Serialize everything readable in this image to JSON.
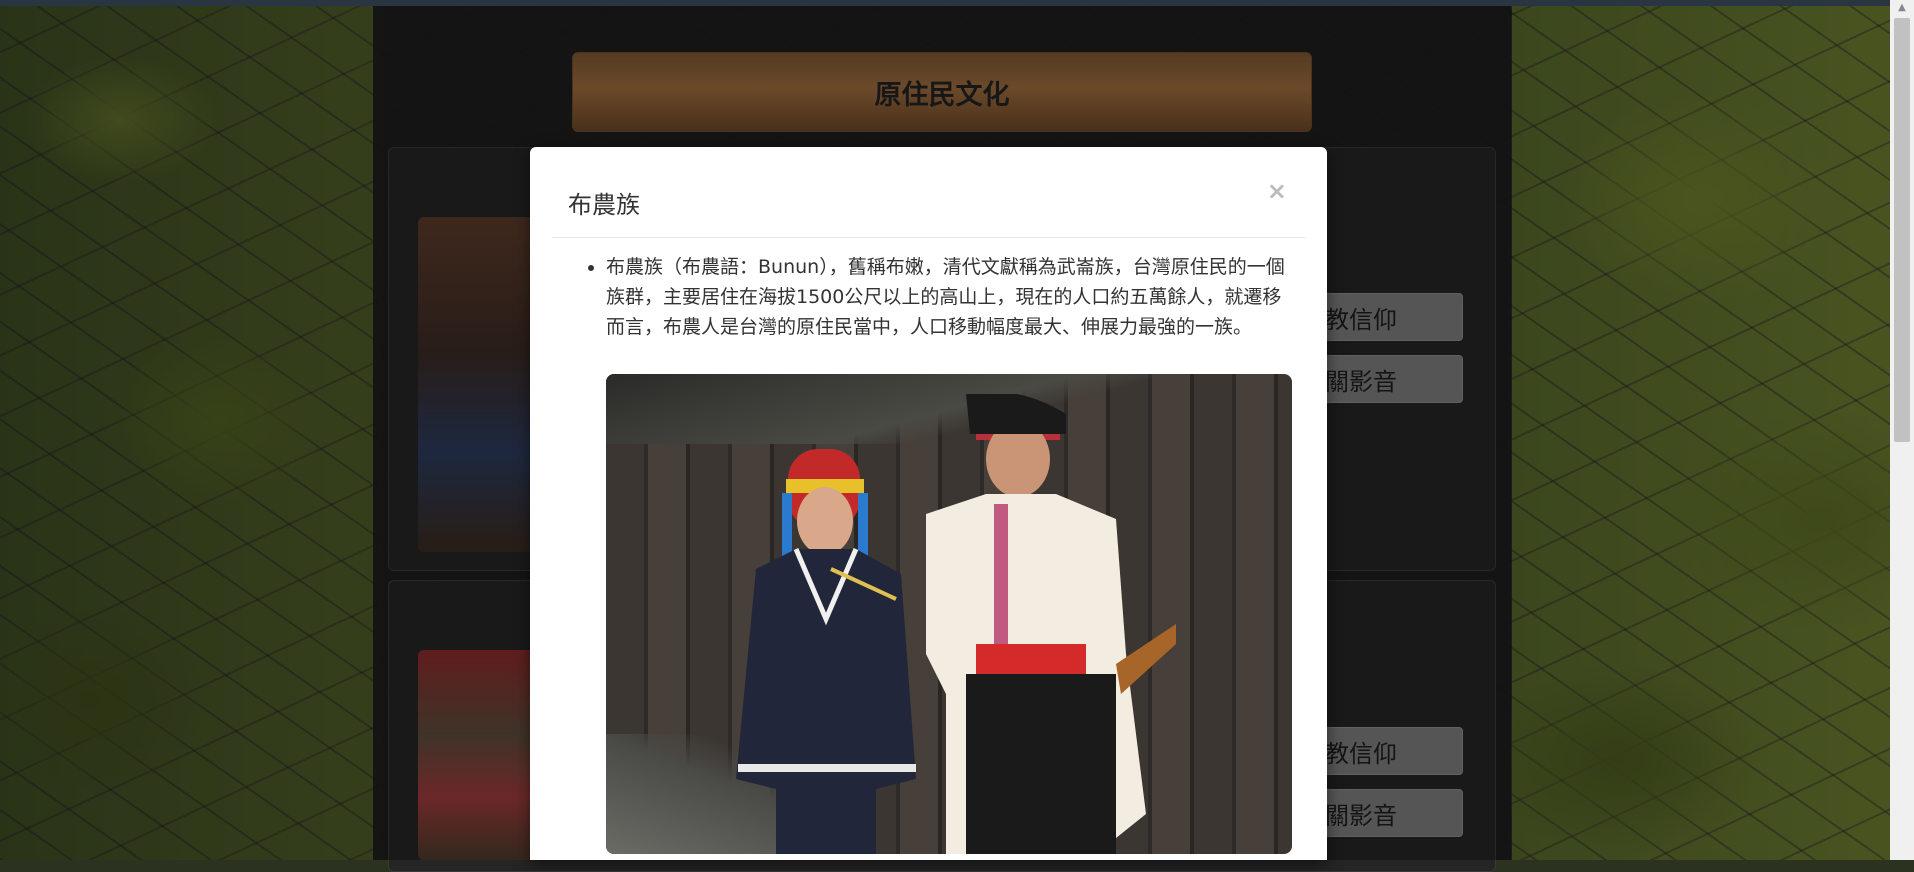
{
  "page": {
    "title": "原住民文化",
    "side_buttons": [
      {
        "label": "教信仰"
      },
      {
        "label": "關影音"
      },
      {
        "label": "教信仰"
      },
      {
        "label": "關影音"
      }
    ]
  },
  "modal": {
    "title": "布農族",
    "close_glyph": "×",
    "description": "布農族（布農語：Bunun），舊稱布嫩，清代文獻稱為武崙族，台灣原住民的一個族群，主要居住在海拔1500公尺以上的高山上，現在的人口約五萬餘人，就遷移而言，布農人是台灣的原住民當中，人口移動幅度最大、伸展力最強的一族。"
  },
  "colors": {
    "title_bar": "#8a5e36",
    "modal_bg": "#ffffff",
    "side_button": "#7a7a7a"
  }
}
